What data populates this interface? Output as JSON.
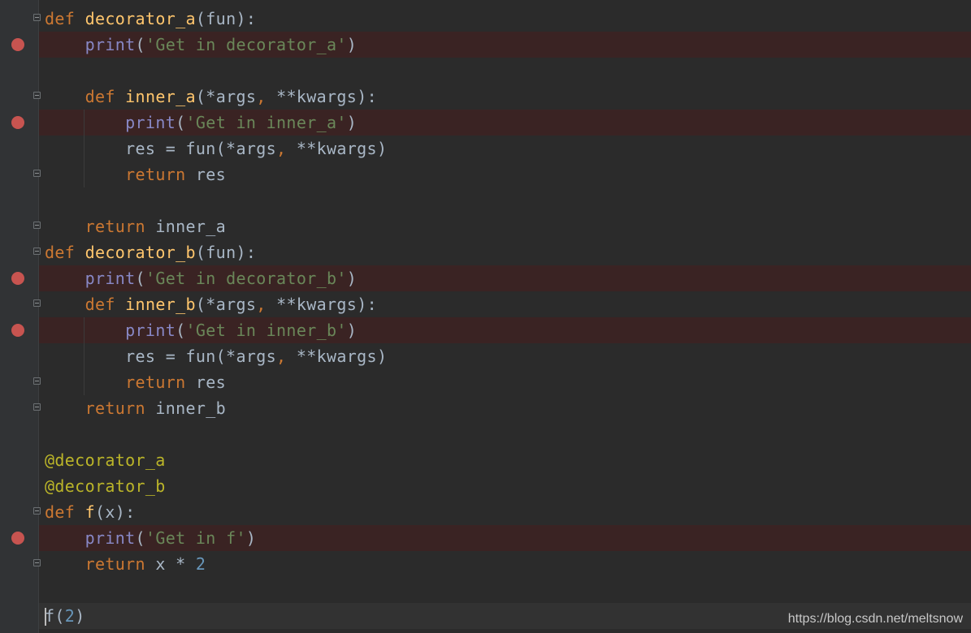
{
  "editor": {
    "lines": [
      {
        "indent": "",
        "parts": [
          [
            "kw",
            "def "
          ],
          [
            "fn",
            "decorator_a"
          ],
          [
            "tx",
            "(fun):"
          ]
        ],
        "breakpoint": false,
        "fold": "open"
      },
      {
        "indent": "    ",
        "parts": [
          [
            "bi",
            "print"
          ],
          [
            "tx",
            "("
          ],
          [
            "st",
            "'Get in decorator_a'"
          ],
          [
            "tx",
            ")"
          ]
        ],
        "breakpoint": true,
        "fold": ""
      },
      {
        "indent": "",
        "parts": [],
        "breakpoint": false,
        "fold": ""
      },
      {
        "indent": "    ",
        "parts": [
          [
            "kw",
            "def "
          ],
          [
            "fn",
            "inner_a"
          ],
          [
            "tx",
            "(*args"
          ],
          [
            "pu",
            ", "
          ],
          [
            "tx",
            "**kwargs):"
          ]
        ],
        "breakpoint": false,
        "fold": "open"
      },
      {
        "indent": "        ",
        "parts": [
          [
            "bi",
            "print"
          ],
          [
            "tx",
            "("
          ],
          [
            "st",
            "'Get in inner_a'"
          ],
          [
            "tx",
            ")"
          ]
        ],
        "breakpoint": true,
        "fold": ""
      },
      {
        "indent": "        ",
        "parts": [
          [
            "tx",
            "res = fun(*args"
          ],
          [
            "pu",
            ", "
          ],
          [
            "tx",
            "**kwargs)"
          ]
        ],
        "breakpoint": false,
        "fold": ""
      },
      {
        "indent": "        ",
        "parts": [
          [
            "kw",
            "return "
          ],
          [
            "tx",
            "res"
          ]
        ],
        "breakpoint": false,
        "fold": "close"
      },
      {
        "indent": "",
        "parts": [],
        "breakpoint": false,
        "fold": ""
      },
      {
        "indent": "    ",
        "parts": [
          [
            "kw",
            "return "
          ],
          [
            "tx",
            "inner_a"
          ]
        ],
        "breakpoint": false,
        "fold": "close"
      },
      {
        "indent": "",
        "parts": [
          [
            "kw",
            "def "
          ],
          [
            "fn",
            "decorator_b"
          ],
          [
            "tx",
            "(fun):"
          ]
        ],
        "breakpoint": false,
        "fold": "open"
      },
      {
        "indent": "    ",
        "parts": [
          [
            "bi",
            "print"
          ],
          [
            "tx",
            "("
          ],
          [
            "st",
            "'Get in decorator_b'"
          ],
          [
            "tx",
            ")"
          ]
        ],
        "breakpoint": true,
        "fold": ""
      },
      {
        "indent": "    ",
        "parts": [
          [
            "kw",
            "def "
          ],
          [
            "fn",
            "inner_b"
          ],
          [
            "tx",
            "(*args"
          ],
          [
            "pu",
            ", "
          ],
          [
            "tx",
            "**kwargs):"
          ]
        ],
        "breakpoint": false,
        "fold": "open"
      },
      {
        "indent": "        ",
        "parts": [
          [
            "bi",
            "print"
          ],
          [
            "tx",
            "("
          ],
          [
            "st",
            "'Get in inner_b'"
          ],
          [
            "tx",
            ")"
          ]
        ],
        "breakpoint": true,
        "fold": ""
      },
      {
        "indent": "        ",
        "parts": [
          [
            "tx",
            "res = fun(*args"
          ],
          [
            "pu",
            ", "
          ],
          [
            "tx",
            "**kwargs)"
          ]
        ],
        "breakpoint": false,
        "fold": ""
      },
      {
        "indent": "        ",
        "parts": [
          [
            "kw",
            "return "
          ],
          [
            "tx",
            "res"
          ]
        ],
        "breakpoint": false,
        "fold": "close"
      },
      {
        "indent": "    ",
        "parts": [
          [
            "kw",
            "return "
          ],
          [
            "tx",
            "inner_b"
          ]
        ],
        "breakpoint": false,
        "fold": "close"
      },
      {
        "indent": "",
        "parts": [],
        "breakpoint": false,
        "fold": ""
      },
      {
        "indent": "",
        "parts": [
          [
            "dec",
            "@decorator_a"
          ]
        ],
        "breakpoint": false,
        "fold": ""
      },
      {
        "indent": "",
        "parts": [
          [
            "dec",
            "@decorator_b"
          ]
        ],
        "breakpoint": false,
        "fold": ""
      },
      {
        "indent": "",
        "parts": [
          [
            "kw",
            "def "
          ],
          [
            "fn",
            "f"
          ],
          [
            "tx",
            "(x):"
          ]
        ],
        "breakpoint": false,
        "fold": "open"
      },
      {
        "indent": "    ",
        "parts": [
          [
            "bi",
            "print"
          ],
          [
            "tx",
            "("
          ],
          [
            "st",
            "'Get in f'"
          ],
          [
            "tx",
            ")"
          ]
        ],
        "breakpoint": true,
        "fold": ""
      },
      {
        "indent": "    ",
        "parts": [
          [
            "kw",
            "return "
          ],
          [
            "tx",
            "x * "
          ],
          [
            "num",
            "2"
          ]
        ],
        "breakpoint": false,
        "fold": "close"
      },
      {
        "indent": "",
        "parts": [],
        "breakpoint": false,
        "fold": ""
      },
      {
        "indent": "",
        "parts": [
          [
            "tx",
            "f("
          ],
          [
            "num",
            "2"
          ],
          [
            "tx",
            ")"
          ]
        ],
        "breakpoint": false,
        "fold": "",
        "caret": true
      }
    ]
  },
  "watermark": "https://blog.csdn.net/meltsnow",
  "colors": {
    "background": "#2b2b2b",
    "gutter": "#313335",
    "breakpoint": "#c75450",
    "breakpoint_line": "#3a2323",
    "keyword": "#cc7832",
    "function": "#ffc66d",
    "builtin": "#8888c6",
    "string": "#6a8759",
    "number": "#6897bb",
    "decorator": "#bbb529",
    "text": "#a9b7c6"
  }
}
